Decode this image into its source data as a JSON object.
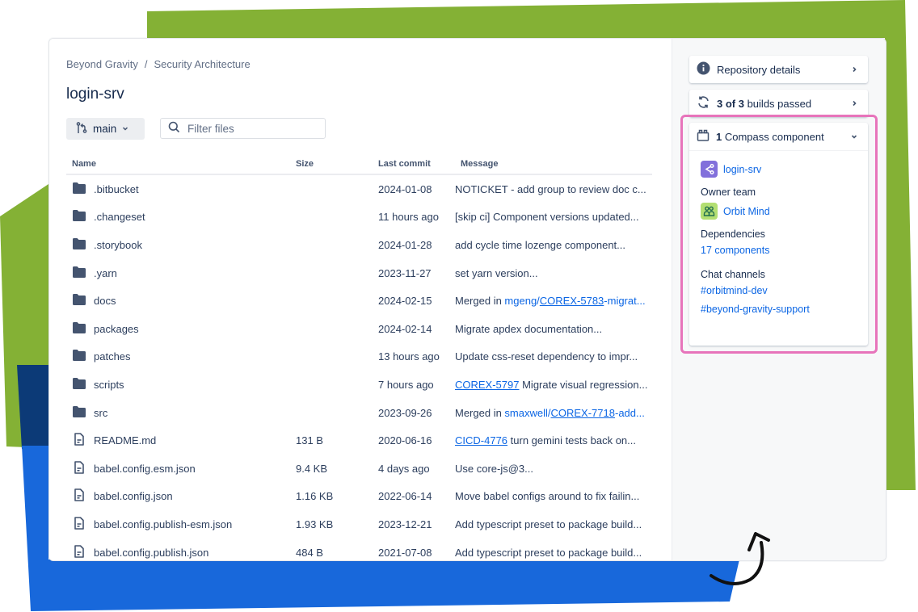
{
  "colors": {
    "green": "#84b135",
    "blue": "#1868db",
    "navy": "#0c3a77",
    "highlight": "#e774bb",
    "link": "#0c66e4"
  },
  "breadcrumb": [
    "Beyond Gravity",
    "Security Architecture"
  ],
  "breadcrumb_sep": "/",
  "page_title": "login-srv",
  "branch": {
    "label": "main",
    "icon": "git-branch-icon"
  },
  "filter": {
    "placeholder": "Filter files",
    "value": ""
  },
  "table": {
    "columns": [
      "Name",
      "Size",
      "Last commit",
      "Message"
    ],
    "rows": [
      {
        "type": "folder",
        "name": ".bitbucket",
        "size": "",
        "commit": "2024-01-08",
        "message": [
          {
            "t": "NOTICKET - add group to review doc c..."
          }
        ]
      },
      {
        "type": "folder",
        "name": ".changeset",
        "size": "",
        "commit": "11 hours ago",
        "message": [
          {
            "t": "[skip ci] Component versions updated..."
          }
        ]
      },
      {
        "type": "folder",
        "name": ".storybook",
        "size": "",
        "commit": "2024-01-28",
        "message": [
          {
            "t": "add cycle time lozenge component..."
          }
        ]
      },
      {
        "type": "folder",
        "name": ".yarn",
        "size": "",
        "commit": "2023-11-27",
        "message": [
          {
            "t": "set yarn version..."
          }
        ]
      },
      {
        "type": "folder",
        "name": "docs",
        "size": "",
        "commit": "2024-02-15",
        "message": [
          {
            "t": "Merged in "
          },
          {
            "t": "mgeng/",
            "link": true
          },
          {
            "t": "COREX-5783",
            "link": true,
            "u": true
          },
          {
            "t": "-migrat...",
            "link": true
          }
        ]
      },
      {
        "type": "folder",
        "name": "packages",
        "size": "",
        "commit": "2024-02-14",
        "message": [
          {
            "t": "Migrate apdex documentation..."
          }
        ]
      },
      {
        "type": "folder",
        "name": "patches",
        "size": "",
        "commit": "13 hours ago",
        "message": [
          {
            "t": "Update css-reset dependency to impr..."
          }
        ]
      },
      {
        "type": "folder",
        "name": "scripts",
        "size": "",
        "commit": "7 hours ago",
        "message": [
          {
            "t": "COREX-5797",
            "link": true,
            "u": true
          },
          {
            "t": " Migrate visual regression..."
          }
        ]
      },
      {
        "type": "folder",
        "name": "src",
        "size": "",
        "commit": "2023-09-26",
        "message": [
          {
            "t": "Merged in "
          },
          {
            "t": "smaxwell/",
            "link": true
          },
          {
            "t": "COREX-7718",
            "link": true,
            "u": true
          },
          {
            "t": "-add...",
            "link": true
          }
        ]
      },
      {
        "type": "file",
        "name": "README.md",
        "size": "131 B",
        "commit": "2020-06-16",
        "message": [
          {
            "t": "CICD-4776",
            "link": true,
            "u": true
          },
          {
            "t": " turn gemini tests back on..."
          }
        ]
      },
      {
        "type": "file",
        "name": "babel.config.esm.json",
        "size": "9.4 KB",
        "commit": "4 days ago",
        "message": [
          {
            "t": "Use core-js@3..."
          }
        ]
      },
      {
        "type": "file",
        "name": "babel.config.json",
        "size": "1.16 KB",
        "commit": "2022-06-14",
        "message": [
          {
            "t": "Move babel configs around to fix failin..."
          }
        ]
      },
      {
        "type": "file",
        "name": "babel.config.publish-esm.json",
        "size": "1.93 KB",
        "commit": "2023-12-21",
        "message": [
          {
            "t": "Add typescript preset to package build..."
          }
        ]
      },
      {
        "type": "file",
        "name": "babel.config.publish.json",
        "size": "484 B",
        "commit": "2021-07-08",
        "message": [
          {
            "t": "Add typescript preset to package build..."
          }
        ]
      }
    ]
  },
  "sidebar": {
    "repo_details": {
      "label": "Repository details",
      "icon": "info-icon"
    },
    "builds": {
      "count": "3 of 3",
      "label": " builds passed",
      "icon": "refresh-icon"
    },
    "compass": {
      "count": "1",
      "label": " Compass component",
      "icon": "component-icon",
      "component": {
        "name": "login-srv",
        "icon": "service-icon"
      },
      "owner_team_label": "Owner team",
      "owner_team": {
        "name": "Orbit Mind",
        "icon": "team-icon"
      },
      "dependencies_label": "Dependencies",
      "dependencies": "17 components",
      "chat_label": "Chat channels",
      "chat_channels": [
        "#orbitmind-dev",
        "#beyond-gravity-support"
      ]
    }
  }
}
